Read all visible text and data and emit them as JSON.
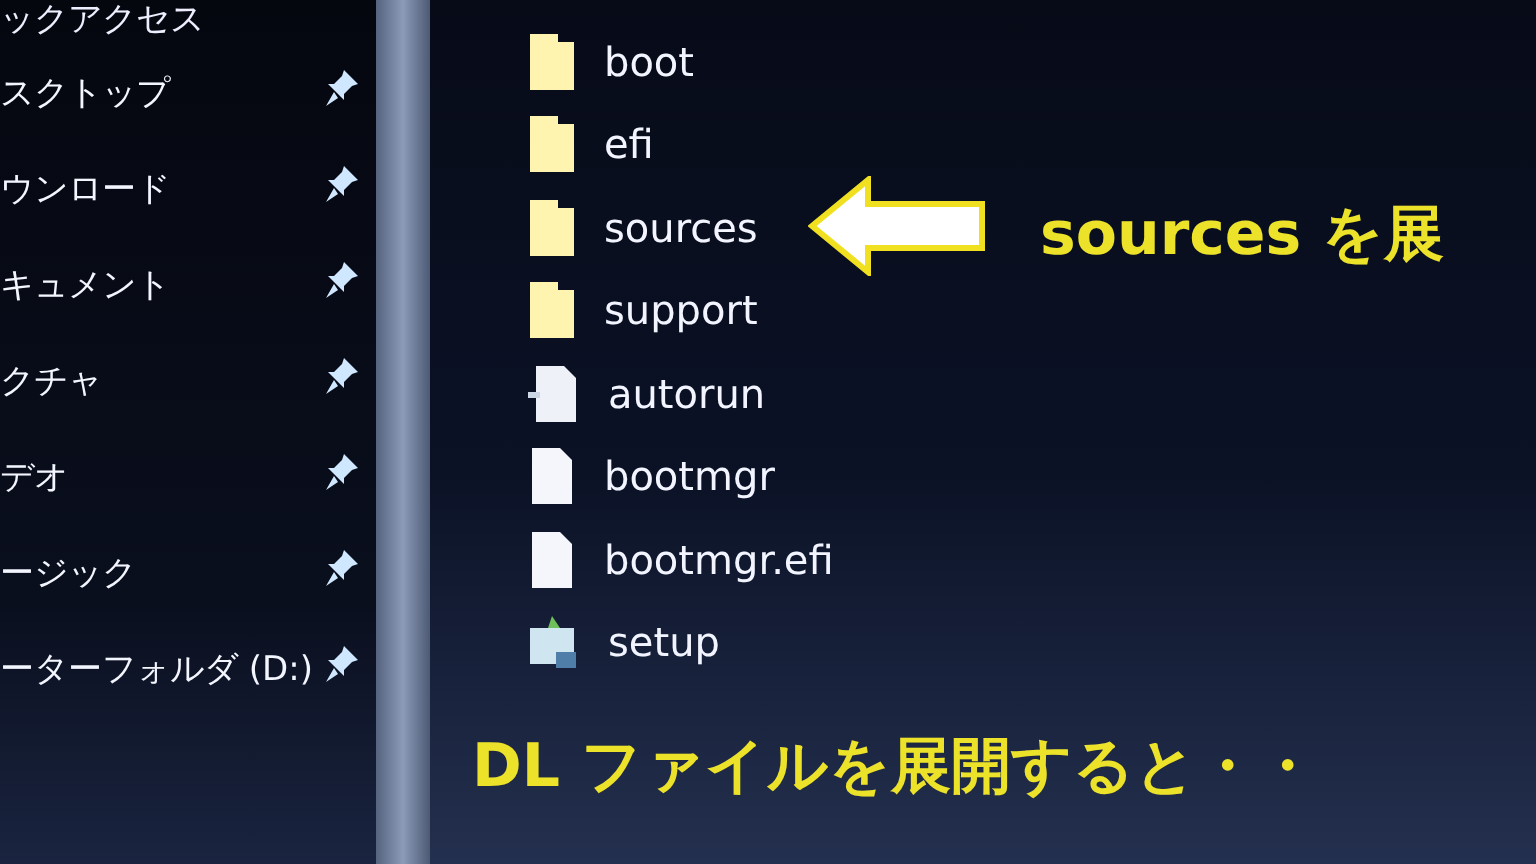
{
  "nav_pane": {
    "header": "ックアクセス",
    "items": [
      {
        "label": "スクトップ",
        "pinned": true
      },
      {
        "label": "ウンロード",
        "pinned": true
      },
      {
        "label": "キュメント",
        "pinned": true
      },
      {
        "label": "クチャ",
        "pinned": true
      },
      {
        "label": "デオ",
        "pinned": true
      },
      {
        "label": "ージック",
        "pinned": true
      },
      {
        "label": "ーターフォルダ (D:)",
        "pinned": true
      }
    ]
  },
  "files": [
    {
      "name": "boot",
      "kind": "folder"
    },
    {
      "name": "efi",
      "kind": "folder"
    },
    {
      "name": "sources",
      "kind": "folder"
    },
    {
      "name": "support",
      "kind": "folder"
    },
    {
      "name": "autorun",
      "kind": "settings"
    },
    {
      "name": "bootmgr",
      "kind": "file"
    },
    {
      "name": "bootmgr.efi",
      "kind": "file"
    },
    {
      "name": "setup",
      "kind": "app"
    }
  ],
  "annotations": {
    "arrow_text": "sources を展",
    "caption": "DL ファイルを展開すると・・"
  }
}
